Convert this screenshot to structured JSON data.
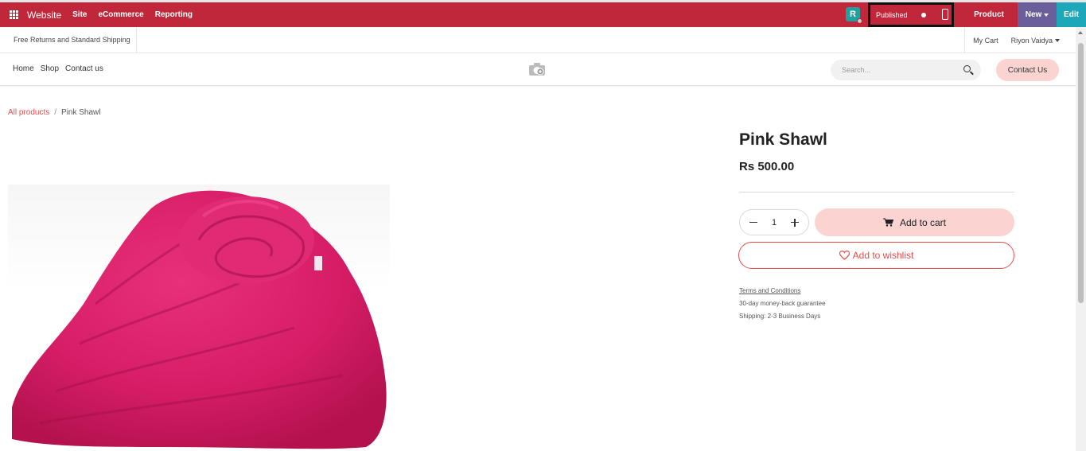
{
  "topbar": {
    "brand": "Website",
    "menus": [
      "Site",
      "eCommerce",
      "Reporting"
    ],
    "avatar_letter": "R",
    "published_label": "Published",
    "product_label": "Product",
    "new_label": "New",
    "edit_label": "Edit",
    "colors": {
      "bar": "#c0273b",
      "new": "#6b5f9b",
      "edit": "#1ea7b8"
    }
  },
  "announcement": {
    "shipping_text": "Free Returns and Standard Shipping",
    "cart_label": "My Cart",
    "user_name": "Riyon Vaidya"
  },
  "nav": {
    "links": [
      "Home",
      "Shop",
      "Contact us"
    ],
    "search_placeholder": "Search...",
    "contact_button": "Contact Us"
  },
  "breadcrumb": {
    "parent": "All products",
    "separator": "/",
    "current": "Pink Shawl"
  },
  "product": {
    "name": "Pink Shawl",
    "price": "Rs 500.00",
    "quantity": "1",
    "add_to_cart": "Add to cart",
    "add_to_wishlist": "Add to wishlist",
    "terms": "Terms and Conditions",
    "guarantee": "30-day money-back guarantee",
    "shipping": "Shipping: 2-3 Business Days",
    "image_icon": "pink-shawl-image"
  }
}
